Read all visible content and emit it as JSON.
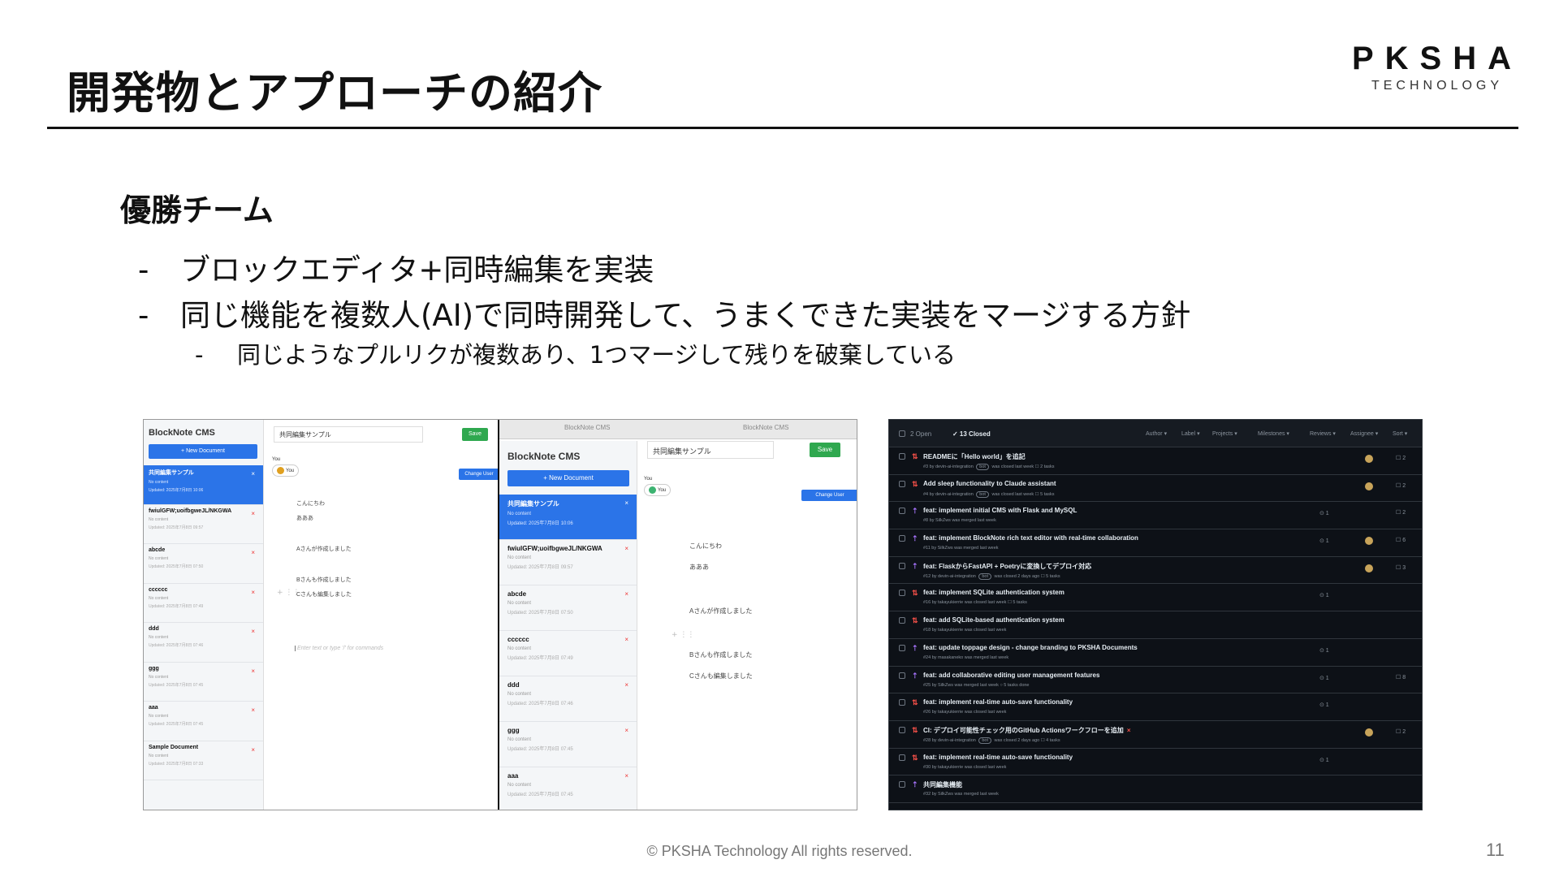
{
  "slide": {
    "title": "開発物とアプローチの紹介",
    "logo_main": "PKSHA",
    "logo_sub": "TECHNOLOGY",
    "subheading": "優勝チーム",
    "bullet1": "ブロックエディタ+同時編集を実装",
    "bullet2": "同じ機能を複数人(AI)で同時開発して、うまくできた実装をマージする方針",
    "bullet3": "同じようなプルリクが複数あり、1つマージして残りを破棄している",
    "dash": "-",
    "footer": "© PKSHA Technology All rights reserved.",
    "page_number": "11"
  },
  "cms": {
    "app_title": "BlockNote CMS",
    "tab_label": "BlockNote CMS",
    "new_doc_label": "+ New Document",
    "doc_title_value": "共同編集サンプル",
    "save_label": "Save",
    "you_label": "You",
    "you_pill": "You",
    "change_user_label": "Change User",
    "editor_line1": "こんにちわ",
    "editor_line2": "あああ",
    "editor_line3": "Aさんが作成しました",
    "editor_line4": "Bさんも作成しました",
    "editor_line5": "Cさんも編集しました",
    "placeholder": "Enter text or type '/' for commands",
    "close_glyph": "×",
    "docsA": [
      {
        "title": "共同編集サンプル",
        "sub": "No content",
        "updated": "Updated: 2025年7月8日 10:06"
      },
      {
        "title": "fwiulGFW;uoifbgweJL/NKGWA",
        "sub": "No content",
        "updated": "Updated: 2025年7月8日 09:57"
      },
      {
        "title": "abcde",
        "sub": "No content",
        "updated": "Updated: 2025年7月8日 07:50"
      },
      {
        "title": "cccccc",
        "sub": "No content",
        "updated": "Updated: 2025年7月8日 07:49"
      },
      {
        "title": "ddd",
        "sub": "No content",
        "updated": "Updated: 2025年7月8日 07:46"
      },
      {
        "title": "ggg",
        "sub": "No content",
        "updated": "Updated: 2025年7月8日 07:45"
      },
      {
        "title": "aaa",
        "sub": "No content",
        "updated": "Updated: 2025年7月8日 07:45"
      },
      {
        "title": "Sample Document",
        "sub": "No content",
        "updated": "Updated: 2025年7月8日 07:33"
      }
    ],
    "docsB": [
      {
        "title": "共同編集サンプル",
        "sub": "No content",
        "updated": "Updated: 2025年7月8日 10:06"
      },
      {
        "title": "fwiulGFW;uoifbgweJL/NKGWA",
        "sub": "No content",
        "updated": "Updated: 2025年7月8日 09:57"
      },
      {
        "title": "abcde",
        "sub": "No content",
        "updated": "Updated: 2025年7月8日 07:50"
      },
      {
        "title": "cccccc",
        "sub": "No content",
        "updated": "Updated: 2025年7月8日 07:49"
      },
      {
        "title": "ddd",
        "sub": "No content",
        "updated": "Updated: 2025年7月8日 07:46"
      },
      {
        "title": "ggg",
        "sub": "No content",
        "updated": "Updated: 2025年7月8日 07:45"
      },
      {
        "title": "aaa",
        "sub": "No content",
        "updated": "Updated: 2025年7月8日 07:45"
      }
    ]
  },
  "github": {
    "open_label": "2 Open",
    "closed_label": "✓ 13 Closed",
    "filters": [
      "Author ▾",
      "Label ▾",
      "Projects ▾",
      "Milestones ▾",
      "Reviews ▾",
      "Assignee ▾",
      "Sort ▾"
    ],
    "rows": [
      {
        "state": "closed",
        "icon": "⇅",
        "title": "READMEに「Hello world」を追記",
        "meta": "#3 by devin-ai-integration",
        "bot": "bot",
        "meta2": "was closed last week ☐ 2 tasks",
        "review": "",
        "avatar": true,
        "comments": "☐ 2",
        "x": ""
      },
      {
        "state": "closed",
        "icon": "⇅",
        "title": "Add sleep functionality to Claude assistant",
        "meta": "#4 by devin-ai-integration",
        "bot": "bot",
        "meta2": "was closed last week ☐ 5 tasks",
        "review": "",
        "avatar": true,
        "comments": "☐ 2",
        "x": ""
      },
      {
        "state": "merged",
        "icon": "⇡",
        "title": "feat: implement initial CMS with Flask and MySQL",
        "meta": "#8 by SilkZws was merged last week",
        "bot": "",
        "meta2": "",
        "review": "⊙ 1",
        "avatar": false,
        "comments": "☐ 2",
        "x": ""
      },
      {
        "state": "merged",
        "icon": "⇡",
        "title": "feat: implement BlockNote rich text editor with real-time collaboration",
        "meta": "#11 by SilkZws was merged last week",
        "bot": "",
        "meta2": "",
        "review": "⊙ 1",
        "avatar": true,
        "comments": "☐ 6",
        "x": ""
      },
      {
        "state": "merged",
        "icon": "⇡",
        "title": "feat: FlaskからFastAPI + Poetryに変換してデプロイ対応",
        "meta": "#12 by devin-ai-integration",
        "bot": "bot",
        "meta2": "was closed 2 days ago ☐ 5 tasks",
        "review": "",
        "avatar": true,
        "comments": "☐ 3",
        "x": ""
      },
      {
        "state": "closed",
        "icon": "⇅",
        "title": "feat: implement SQLite authentication system",
        "meta": "#16 by takayukierrie was closed last week ☐ 5 tasks",
        "bot": "",
        "meta2": "",
        "review": "⊙ 1",
        "avatar": false,
        "comments": "",
        "x": ""
      },
      {
        "state": "closed",
        "icon": "⇅",
        "title": "feat: add SQLite-based authentication system",
        "meta": "#18 by takayukierrie was closed last week",
        "bot": "",
        "meta2": "",
        "review": "",
        "avatar": false,
        "comments": "",
        "x": ""
      },
      {
        "state": "merged",
        "icon": "⇡",
        "title": "feat: update toppage design - change branding to PKSHA Documents",
        "meta": "#24 by masakaneko was merged last week",
        "bot": "",
        "meta2": "",
        "review": "⊙ 1",
        "avatar": false,
        "comments": "",
        "x": ""
      },
      {
        "state": "merged",
        "icon": "⇡",
        "title": "feat: add collaborative editing user management features",
        "meta": "#25 by SilkZws was merged last week ○ 5 tasks done",
        "bot": "",
        "meta2": "",
        "review": "⊙ 1",
        "avatar": false,
        "comments": "☐ 8",
        "x": ""
      },
      {
        "state": "closed",
        "icon": "⇅",
        "title": "feat: implement real-time auto-save functionality",
        "meta": "#26 by takayukierrie was closed last week",
        "bot": "",
        "meta2": "",
        "review": "⊙ 1",
        "avatar": false,
        "comments": "",
        "x": ""
      },
      {
        "state": "closed",
        "icon": "⇅",
        "title": "CI: デプロイ可能性チェック用のGitHub Actionsワークフローを追加",
        "meta": "#28 by devin-ai-integration",
        "bot": "bot",
        "meta2": "was closed 2 days ago ☐ 4 tasks",
        "review": "",
        "avatar": true,
        "comments": "☐ 2",
        "x": "×"
      },
      {
        "state": "closed",
        "icon": "⇅",
        "title": "feat: implement real-time auto-save functionality",
        "meta": "#30 by takayukierrie was closed last week",
        "bot": "",
        "meta2": "",
        "review": "⊙ 1",
        "avatar": false,
        "comments": "",
        "x": ""
      },
      {
        "state": "merged",
        "icon": "⇡",
        "title": "共同編集機能",
        "meta": "#32 by SilkZws was merged last week",
        "bot": "",
        "meta2": "",
        "review": "",
        "avatar": false,
        "comments": "",
        "x": ""
      }
    ]
  }
}
